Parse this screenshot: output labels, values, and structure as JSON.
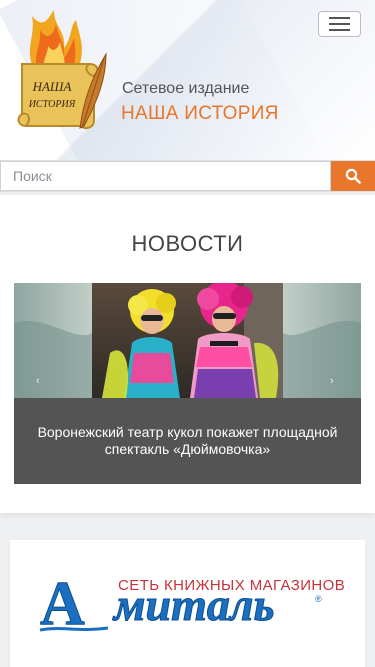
{
  "header": {
    "site_subtitle": "Сетевое издание",
    "site_name": "НАША ИСТОРИЯ",
    "logo_text_line1": "НАША",
    "logo_text_line2": "ИСТОРИЯ"
  },
  "search": {
    "placeholder": "Поиск",
    "icon": "search-icon"
  },
  "news": {
    "heading": "НОВОСТИ",
    "slide_caption": "Воронежский театр кукол покажет площадной спектакль «Дюймовочка»",
    "prev_icon": "chevron-left-icon",
    "next_icon": "chevron-right-icon"
  },
  "banner": {
    "tagline": "СЕТЬ КНИЖНЫХ МАГАЗИНОВ",
    "brand_letter": "А",
    "brand_rest": "миталь",
    "registered": "®"
  },
  "colors": {
    "accent": "#e8762b",
    "caption_bg": "#545454",
    "banner_blue": "#1a6fc0"
  }
}
